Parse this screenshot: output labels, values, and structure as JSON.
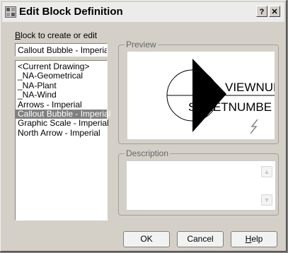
{
  "dialog": {
    "title": "Edit Block Definition",
    "help_glyph": "?",
    "close_glyph": "✕"
  },
  "block": {
    "label_mnemonic": "B",
    "label_rest": "lock to create or edit",
    "current_value": "Callout Bubble - Imperial",
    "items": [
      "<Current Drawing>",
      "_NA-Geometrical",
      "_NA-Plant",
      "_NA-Wind",
      "Arrows - Imperial",
      "Callout Bubble - Imperial",
      "Graphic Scale - Imperial",
      "North Arrow - Imperial"
    ],
    "selected_index": 5
  },
  "preview": {
    "label": "Preview",
    "line1": "VIEWNUMBE",
    "line2": "SHEETNUMBE"
  },
  "description": {
    "label": "Description",
    "value": ""
  },
  "buttons": {
    "ok": "OK",
    "cancel": "Cancel",
    "help_mnemonic": "H",
    "help_rest": "elp"
  }
}
